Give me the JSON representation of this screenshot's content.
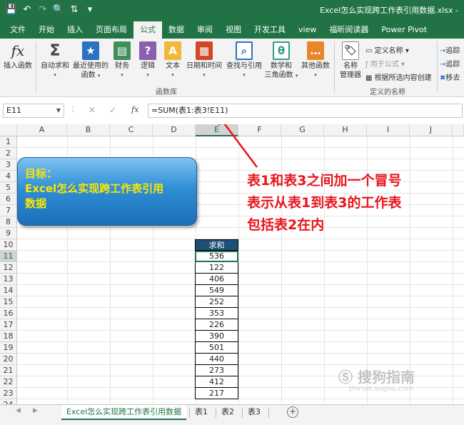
{
  "titlebar": {
    "doc_title": "Excel怎么实现跨工作表引用数据.xlsx  -",
    "qat": [
      "save-icon",
      "undo-icon",
      "redo-icon",
      "print-preview-icon",
      "sort-icon",
      "customize-icon"
    ]
  },
  "tabs": [
    "文件",
    "开始",
    "插入",
    "页面布局",
    "公式",
    "数据",
    "审阅",
    "视图",
    "开发工具",
    "view",
    "福昕阅读器",
    "Power Pivot"
  ],
  "active_tab": "公式",
  "ribbon": {
    "insert_function": "插入函数",
    "buttons": [
      {
        "icon": "sum-icon",
        "label": "自动求和",
        "caret": "▾"
      },
      {
        "icon": "star-icon",
        "label": "最近使用的",
        "label2": "函数",
        "caret": "▾"
      },
      {
        "icon": "finance-icon",
        "label": "财务",
        "caret": "▾"
      },
      {
        "icon": "logic-icon",
        "label": "逻辑",
        "caret": "▾"
      },
      {
        "icon": "text-icon",
        "label": "文本",
        "caret": "▾"
      },
      {
        "icon": "datetime-icon",
        "label": "日期和时间",
        "caret": "▾"
      },
      {
        "icon": "lookup-icon",
        "label": "查找与引用",
        "caret": "▾"
      },
      {
        "icon": "math-icon",
        "label": "数学和",
        "label2": "三角函数",
        "caret": "▾"
      },
      {
        "icon": "more-functions-icon",
        "label": "其他函数",
        "caret": "▾"
      }
    ],
    "function_library_label": "函数库",
    "name_manager": "名称",
    "name_manager2": "管理器",
    "define_name": "定义名称",
    "use_in_formula": "用于公式",
    "create_from_selection": "根据所选内容创建",
    "defined_names_label": "定义的名称",
    "trace1": "追踪",
    "trace2": "追踪",
    "remove": "移去"
  },
  "formula_bar": {
    "name_box": "E11",
    "formula": "=SUM(表1:表3!E11)"
  },
  "grid": {
    "columns": [
      "A",
      "B",
      "C",
      "D",
      "E",
      "F",
      "G",
      "H",
      "I",
      "J"
    ],
    "selected_column": "E",
    "rows": [
      "1",
      "2",
      "3",
      "4",
      "5",
      "6",
      "7",
      "8",
      "9",
      "10",
      "11",
      "12",
      "13",
      "14",
      "15",
      "16",
      "17",
      "18",
      "19",
      "20",
      "21",
      "22",
      "23",
      "24"
    ],
    "selected_row": "11"
  },
  "goal_box": {
    "line1": "目标：",
    "line2": "Excel怎么实现跨工作表引用",
    "line3": "数据"
  },
  "annotation": {
    "line1": "表1和表3之间加一个冒号",
    "line2": "表示从表1到表3的工作表",
    "line3": "包括表2在内"
  },
  "sum_table": {
    "header": "求和",
    "values": [
      "536",
      "122",
      "406",
      "549",
      "252",
      "353",
      "226",
      "390",
      "501",
      "440",
      "273",
      "412",
      "217"
    ]
  },
  "watermark": {
    "text": "搜狗指南",
    "url": "zhinan.sogou.com"
  },
  "sheets": [
    "Excel怎么实现跨工作表引用数据",
    "表1",
    "表2",
    "表3"
  ],
  "active_sheet": "Excel怎么实现跨工作表引用数据",
  "colors": {
    "excel_green": "#217346",
    "header_fill": "#1f4e79",
    "annotation_red": "#e8151b",
    "goal_text": "#ffe600"
  }
}
